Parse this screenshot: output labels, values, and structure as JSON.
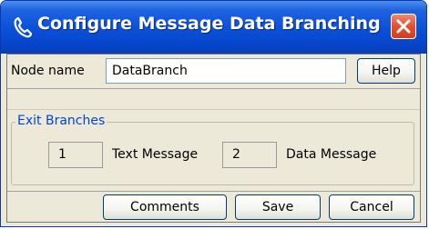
{
  "window": {
    "title": "Configure Message Data Branching",
    "title_icon": "phone-handset-icon",
    "close_icon": "close-icon",
    "colors": {
      "titlebar": "#0a50d8",
      "close": "#e05030",
      "group_title": "#0046d5"
    }
  },
  "node": {
    "label": "Node name",
    "value": "DataBranch",
    "help_label": "Help"
  },
  "exit_branches": {
    "title": "Exit Branches",
    "branches": [
      {
        "number": "1",
        "label": "Text Message"
      },
      {
        "number": "2",
        "label": "Data Message"
      }
    ]
  },
  "footer": {
    "comments_label": "Comments",
    "save_label": "Save",
    "cancel_label": "Cancel"
  }
}
